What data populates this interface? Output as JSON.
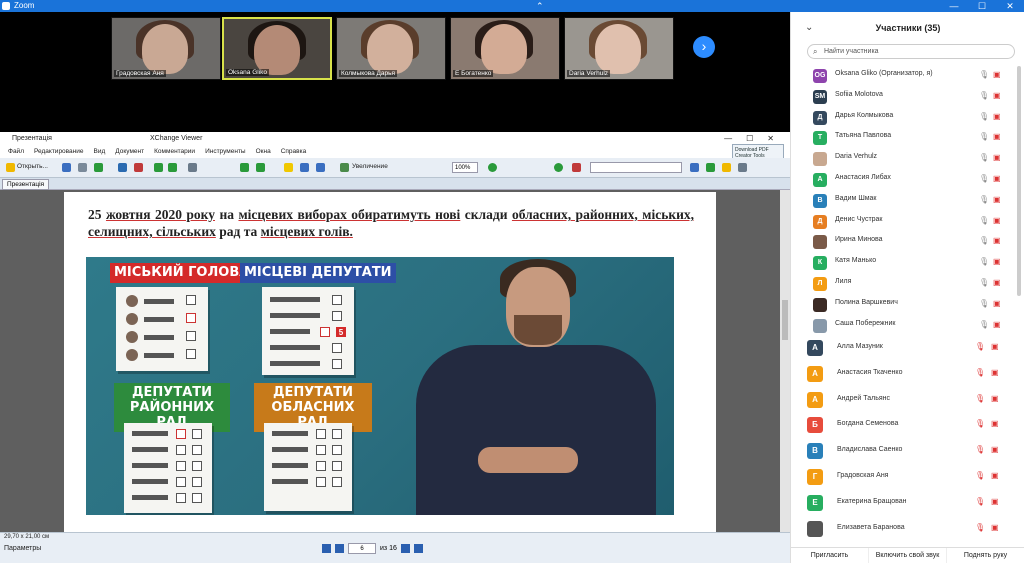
{
  "zoom": {
    "title": "Zoom"
  },
  "window_controls": {
    "min": "—",
    "max": "☐",
    "close": "✕"
  },
  "videos": [
    {
      "name": "Градовская Аня"
    },
    {
      "name": "Oksana Gliko"
    },
    {
      "name": "Колмыкова Дарья"
    },
    {
      "name": "Е Богатенко"
    },
    {
      "name": "Daria Verhulz"
    }
  ],
  "viewer": {
    "title_left": "Презентація",
    "title_center": "XChange Viewer",
    "menu": [
      "Файл",
      "Редактирование",
      "Вид",
      "Документ",
      "Комментарии",
      "Инструменты",
      "Окна",
      "Справка"
    ],
    "logo_text": "Download PDF Creator Tools",
    "open_label": "Открыть...",
    "zoom_label": "Увеличение",
    "zoom_value": "100%",
    "tab_label": "Презентація",
    "page_size": "29,70 x 21,00 см",
    "params_label": "Параметры",
    "page_current": "6",
    "page_total": "из 16"
  },
  "document": {
    "line1_a": "25 ",
    "line1_u1": "жовтня 2020 року",
    "line1_b": " на ",
    "line1_u2": "місцевих виборах обиратимуть нові",
    "line1_c": " склади ",
    "line2_u": "обласних, районних, міських, селищних, сільських",
    "line2_a": " рад та ",
    "line2_u2": "місцевих голів.",
    "banner_mayor": "МІСЬКИЙ ГОЛОВА",
    "banner_local": "МІСЦЕВІ ДЕПУТАТИ",
    "banner_district_1": "ДЕПУТАТИ",
    "banner_district_2": "РАЙОННИХ РАД",
    "banner_oblast_1": "ДЕПУТАТИ",
    "banner_oblast_2": "ОБЛАСНИХ РАД",
    "ballot_number": "5"
  },
  "participants": {
    "title": "Участники (35)",
    "search_placeholder": "Найти участника",
    "list_small": [
      {
        "initials": "OG",
        "color": "#8e44ad",
        "name": "Oksana Gliko (Организатор, я)"
      },
      {
        "initials": "SM",
        "color": "#2c3e50",
        "name": "Sofiia Molotova"
      },
      {
        "initials": "Д",
        "color": "#34495e",
        "name": "Дарья Колмыкова"
      },
      {
        "initials": "Т",
        "color": "#27ae60",
        "name": "Татьяна Павлова"
      },
      {
        "initials": "",
        "color": "#c8a890",
        "name": "Daria Verhulz"
      },
      {
        "initials": "А",
        "color": "#27ae60",
        "name": "Анастасия Либах"
      },
      {
        "initials": "В",
        "color": "#2980b9",
        "name": "Вадим Шмак"
      },
      {
        "initials": "Д",
        "color": "#e67e22",
        "name": "Денис Чустрак"
      },
      {
        "initials": "",
        "color": "#7a5a48",
        "name": "Ирина Минова"
      },
      {
        "initials": "К",
        "color": "#27ae60",
        "name": "Катя Манько"
      },
      {
        "initials": "Л",
        "color": "#f39c12",
        "name": "Лиля"
      },
      {
        "initials": "",
        "color": "#3b2a24",
        "name": "Полина Варшкевич"
      },
      {
        "initials": "",
        "color": "#8899aa",
        "name": "Саша Побережник"
      }
    ],
    "list_large": [
      {
        "initials": "А",
        "color": "#34495e",
        "name": "Алла Мазуник"
      },
      {
        "initials": "А",
        "color": "#f39c12",
        "name": "Анастасия Ткаченко"
      },
      {
        "initials": "А",
        "color": "#f39c12",
        "name": "Андрей Тальянс"
      },
      {
        "initials": "Б",
        "color": "#e74c3c",
        "name": "Богдана Семенова"
      },
      {
        "initials": "В",
        "color": "#2980b9",
        "name": "Владислава Саенко"
      },
      {
        "initials": "Г",
        "color": "#f39c12",
        "name": "Градовская Аня"
      },
      {
        "initials": "Е",
        "color": "#27ae60",
        "name": "Екатерина Бращован"
      },
      {
        "initials": "",
        "color": "#555",
        "name": "Елизавета Баранова"
      }
    ],
    "footer": {
      "invite": "Пригласить",
      "unmute": "Включить свой звук",
      "raise": "Поднять руку"
    }
  }
}
